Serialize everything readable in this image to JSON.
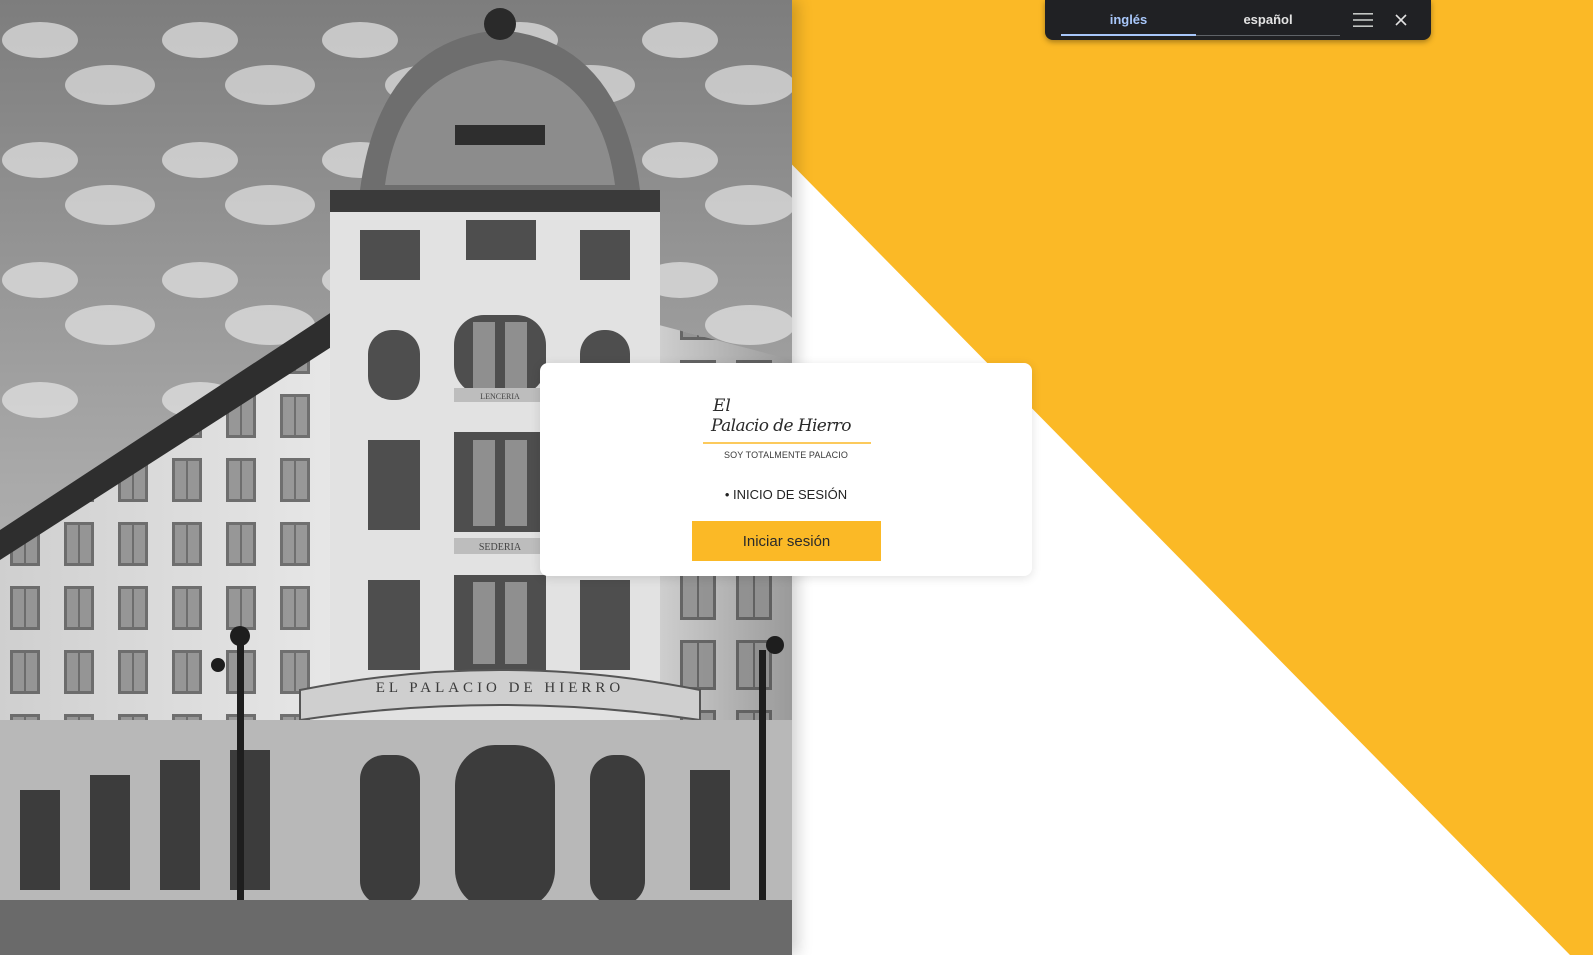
{
  "colors": {
    "accent_yellow": "#fbb926",
    "toolbar_bg": "#202124",
    "toolbar_active": "#a8c7fa",
    "card_bg": "#ffffff"
  },
  "translate_bar": {
    "tabs": [
      {
        "label": "inglés",
        "active": true
      },
      {
        "label": "español",
        "active": false
      }
    ],
    "menu_icon": "hamburger-menu-icon",
    "close_icon": "close-icon"
  },
  "hero_image": {
    "subject": "building-photo",
    "facade_text": "EL PALACIO DE HIERRO",
    "window_signs": [
      "SEDERIA",
      "LENCERIA"
    ]
  },
  "login_card": {
    "logo": {
      "brand_line_1": "El",
      "brand_line_2": "Palacio de Hierro",
      "tagline": "SOY TOTALMENTE PALACIO"
    },
    "section_title": "• INICIO DE SESIÓN",
    "login_button": "Iniciar sesión"
  }
}
